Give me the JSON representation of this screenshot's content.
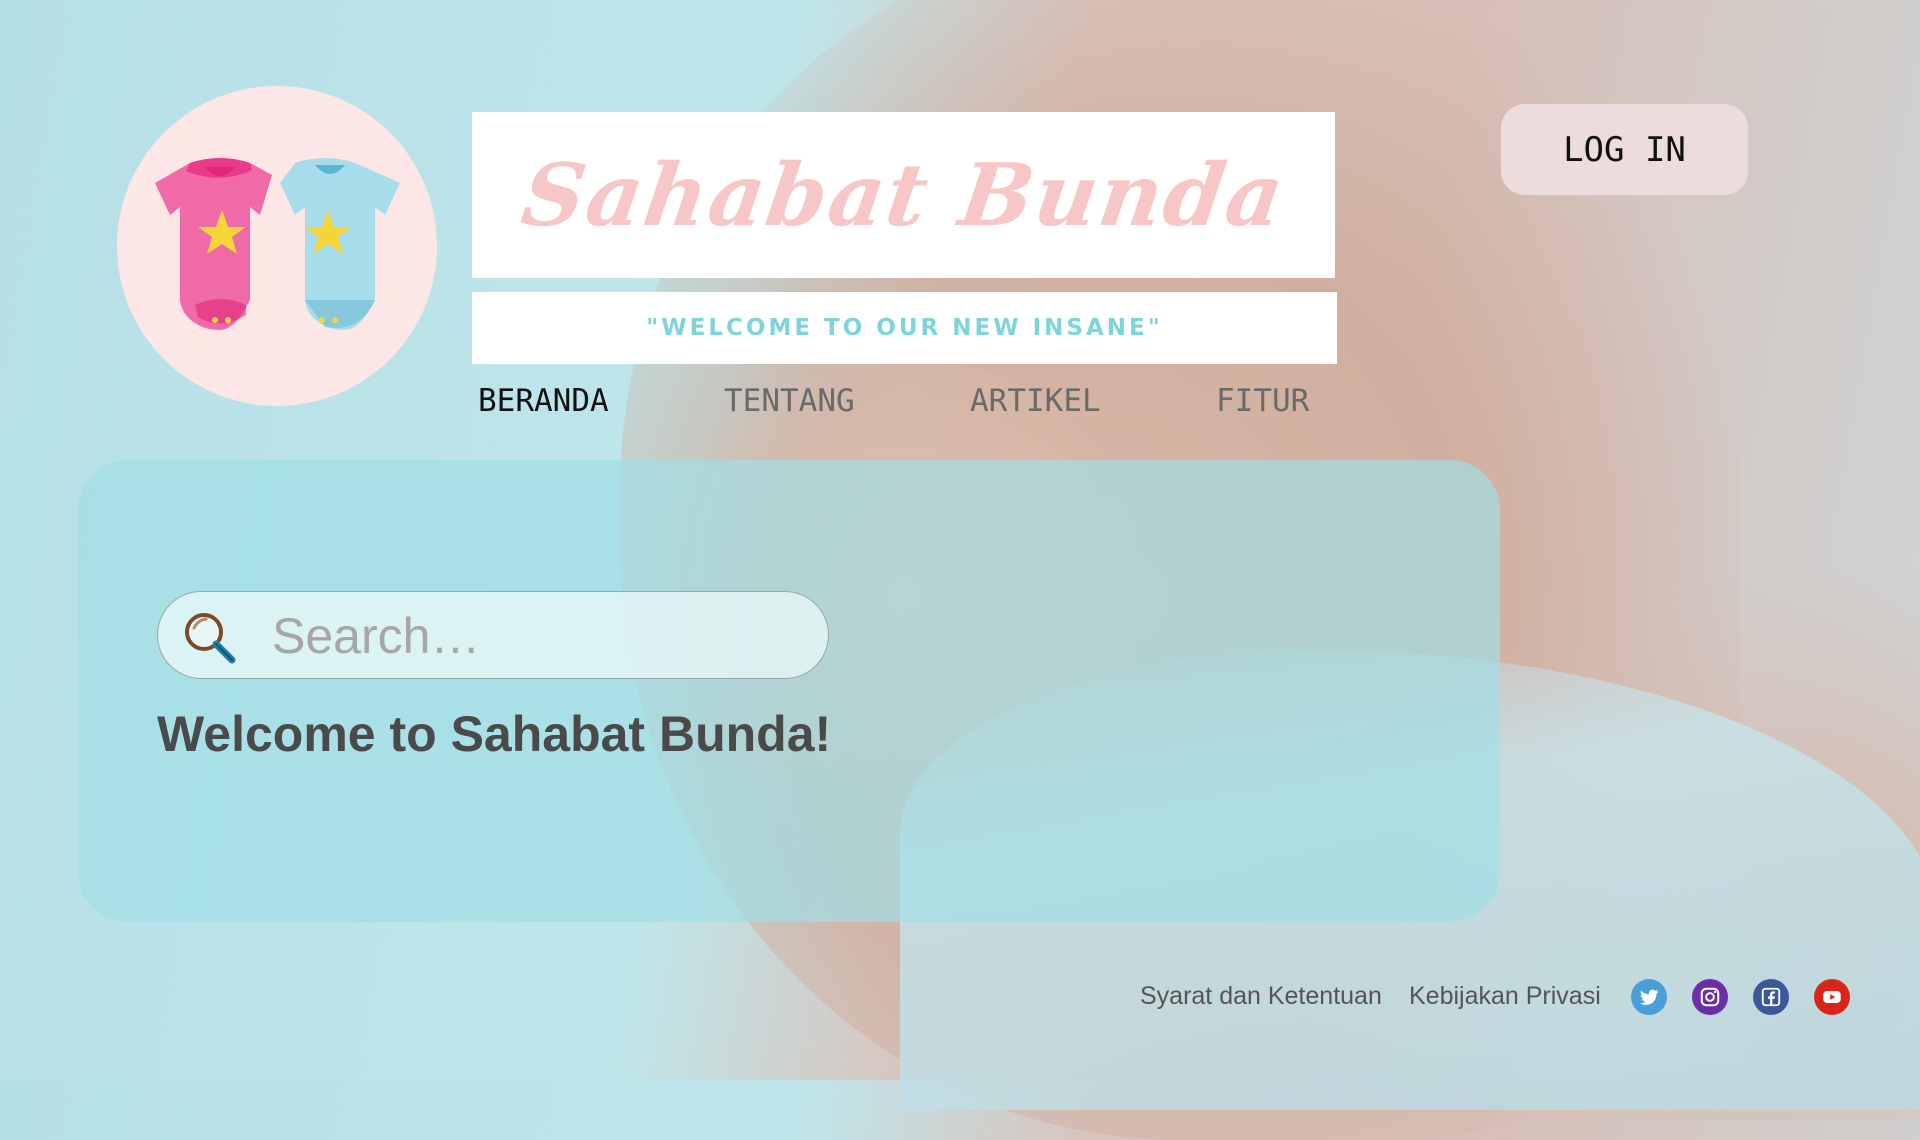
{
  "brand": {
    "title": "Sahabat Bunda",
    "tagline": "\"WELCOME TO OUR NEW INSANE\"",
    "logo_icon": "baby-onesies-icon"
  },
  "header": {
    "login_label": "LOG IN"
  },
  "nav": {
    "items": [
      {
        "label": "BERANDA",
        "active": true
      },
      {
        "label": "TENTANG",
        "active": false
      },
      {
        "label": "ARTIKEL",
        "active": false
      },
      {
        "label": "FITUR",
        "active": false
      }
    ]
  },
  "search": {
    "placeholder": "Search…",
    "value": "",
    "icon": "search-icon"
  },
  "main": {
    "welcome": "Welcome to Sahabat Bunda!"
  },
  "footer": {
    "links": [
      "Syarat dan Ketentuan",
      "Kebijakan Privasi"
    ],
    "social": [
      {
        "icon": "twitter-icon",
        "color": "#4a9fd8"
      },
      {
        "icon": "instagram-icon",
        "color": "#6a2fa8"
      },
      {
        "icon": "facebook-icon",
        "color": "#3b5998"
      },
      {
        "icon": "youtube-icon",
        "color": "#d9261c"
      }
    ]
  },
  "colors": {
    "brand_pink": "#f7c6c6",
    "tagline_teal": "#7fd4dc",
    "panel_teal": "#a0dee6",
    "logo_bg": "#fde6e6",
    "login_bg": "#ecdcdc"
  }
}
